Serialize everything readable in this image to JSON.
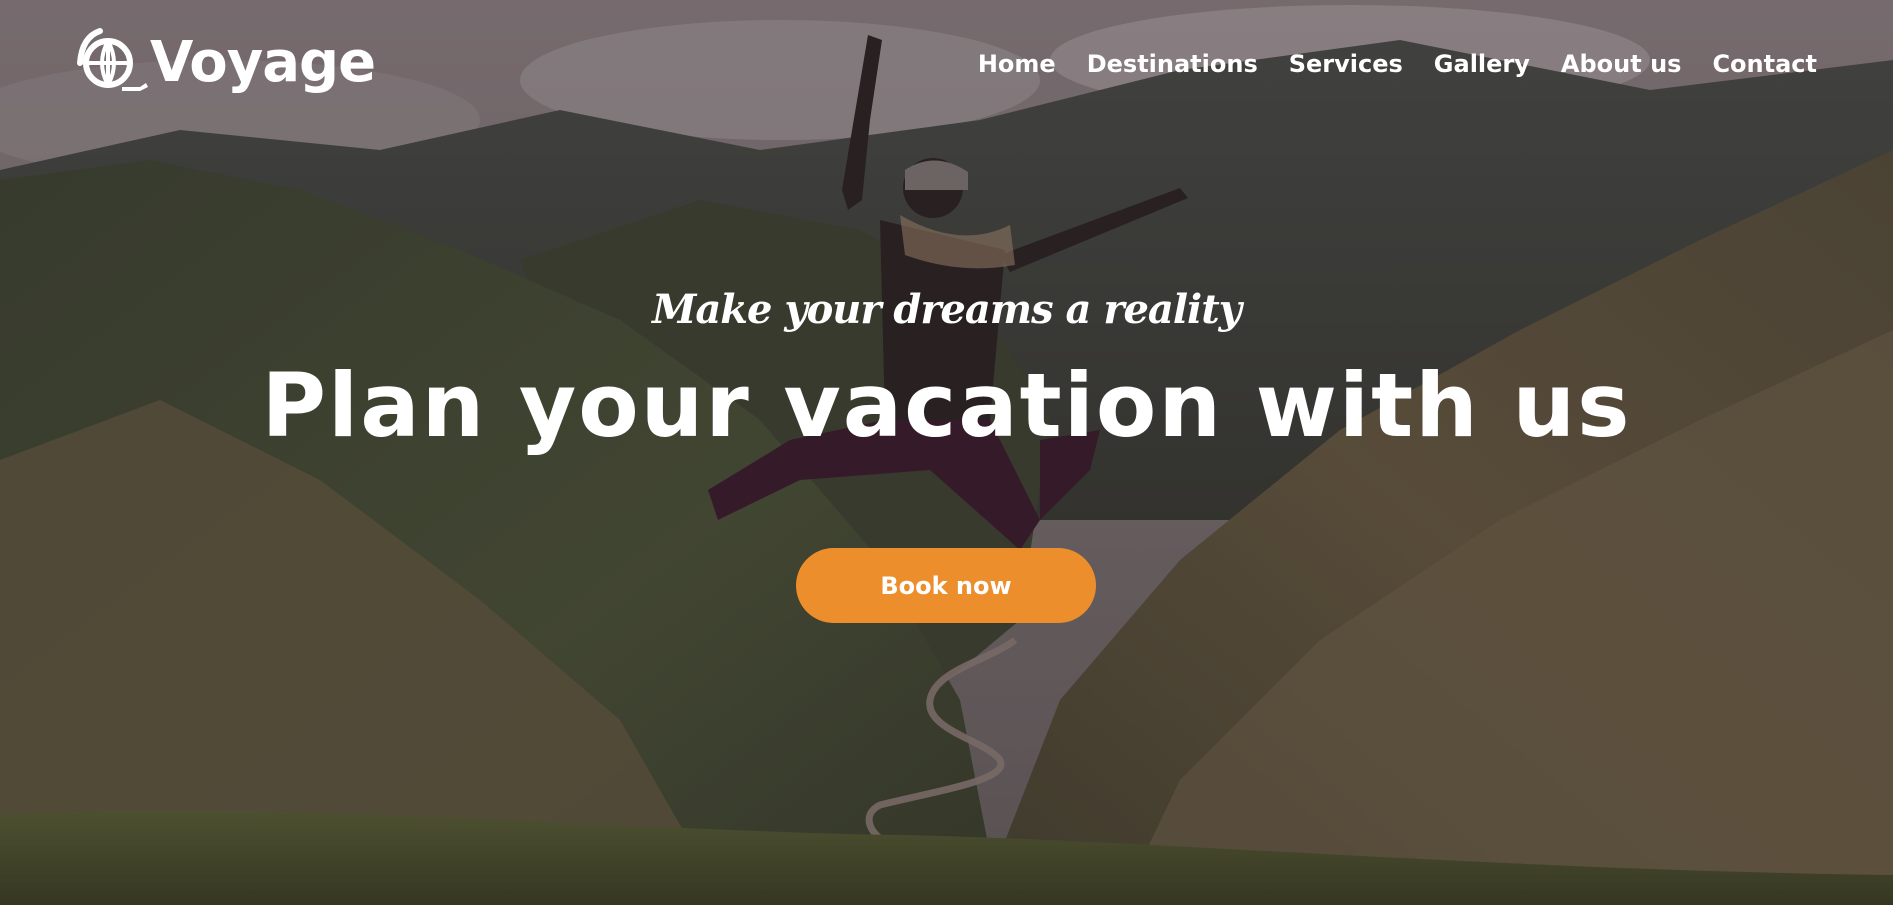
{
  "brand": {
    "name": "Voyage",
    "icon": "globe-with-plane-icon"
  },
  "nav": {
    "items": [
      {
        "label": "Home"
      },
      {
        "label": "Destinations"
      },
      {
        "label": "Services"
      },
      {
        "label": "Gallery"
      },
      {
        "label": "About us"
      },
      {
        "label": "Contact"
      }
    ]
  },
  "hero": {
    "tagline": "Make your dreams a reality",
    "headline": "Plan your vacation with us",
    "cta_label": "Book now",
    "background": "mountain-valley-jumping-traveler-photo"
  },
  "colors": {
    "accent": "#ec8e2c",
    "text": "#ffffff"
  }
}
